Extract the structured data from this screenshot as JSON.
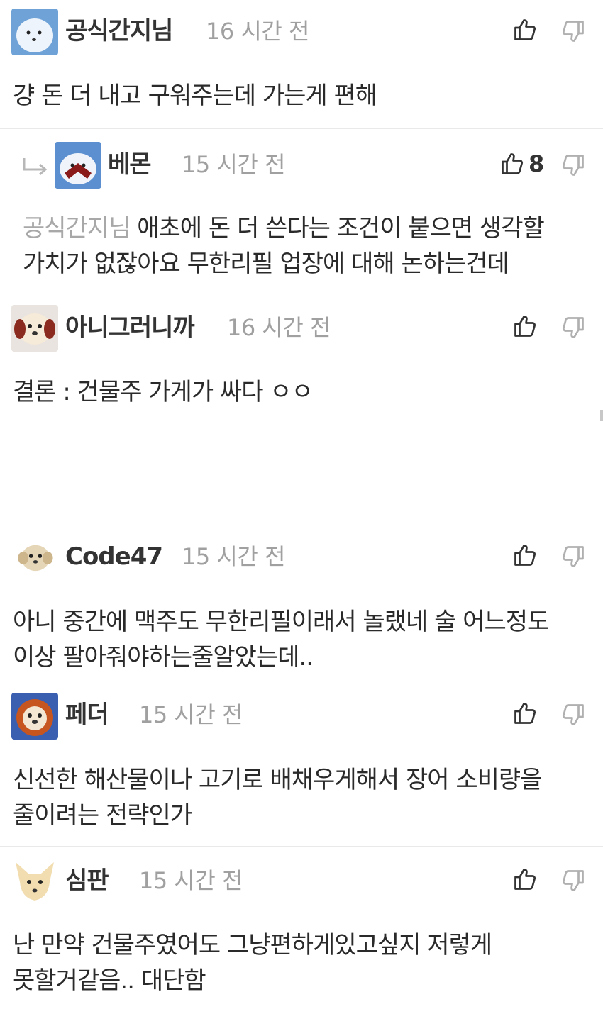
{
  "comments": [
    {
      "nickname": "공식간지님",
      "time": "16 시간 전",
      "text": "걍 돈 더 내고 구워주는데 가는게 편해",
      "avatar": "polar-bear-avatar"
    },
    {
      "nickname": "베몬",
      "time": "15 시간 전",
      "mention": "공식간지님",
      "text": " 애초에 돈 더 쓴다는 조건이 붙으면 생각할 가치가 없잖아요 무한리필 업장에 대해 논하는건데",
      "like_count": "8",
      "avatar": "polar-bear-avatar"
    },
    {
      "nickname": "아니그러니까",
      "time": "16 시간 전",
      "text": "결론 : 건물주 가게가 싸다 ㅇㅇ",
      "avatar": "puppy-avatar"
    },
    {
      "nickname": "Code47",
      "time": "15 시간 전",
      "text": "아니 중간에 맥주도 무한리필이래서 놀랬네 술 어느정도 이상 팔아줘야하는줄알았는데..",
      "avatar": "puppy-avatar"
    },
    {
      "nickname": "페더",
      "time": "15 시간 전",
      "text": "신선한 해산물이나 고기로 배채우게해서 장어 소비량을 줄이려는 전략인가",
      "avatar": "lion-avatar"
    },
    {
      "nickname": "심판",
      "time": "15 시간 전",
      "text": "난 만약 건물주였어도 그냥편하게있고싶지 저렇게 못할거같음.. 대단함",
      "avatar": "dog-avatar"
    }
  ],
  "colors": {
    "nickname": "#333333",
    "time": "#a0a0a0",
    "mention": "#a8a8a8",
    "divider": "#e9e9e9"
  },
  "icons": [
    "thumbs-up-icon",
    "thumbs-down-icon",
    "reply-arrow-icon"
  ]
}
